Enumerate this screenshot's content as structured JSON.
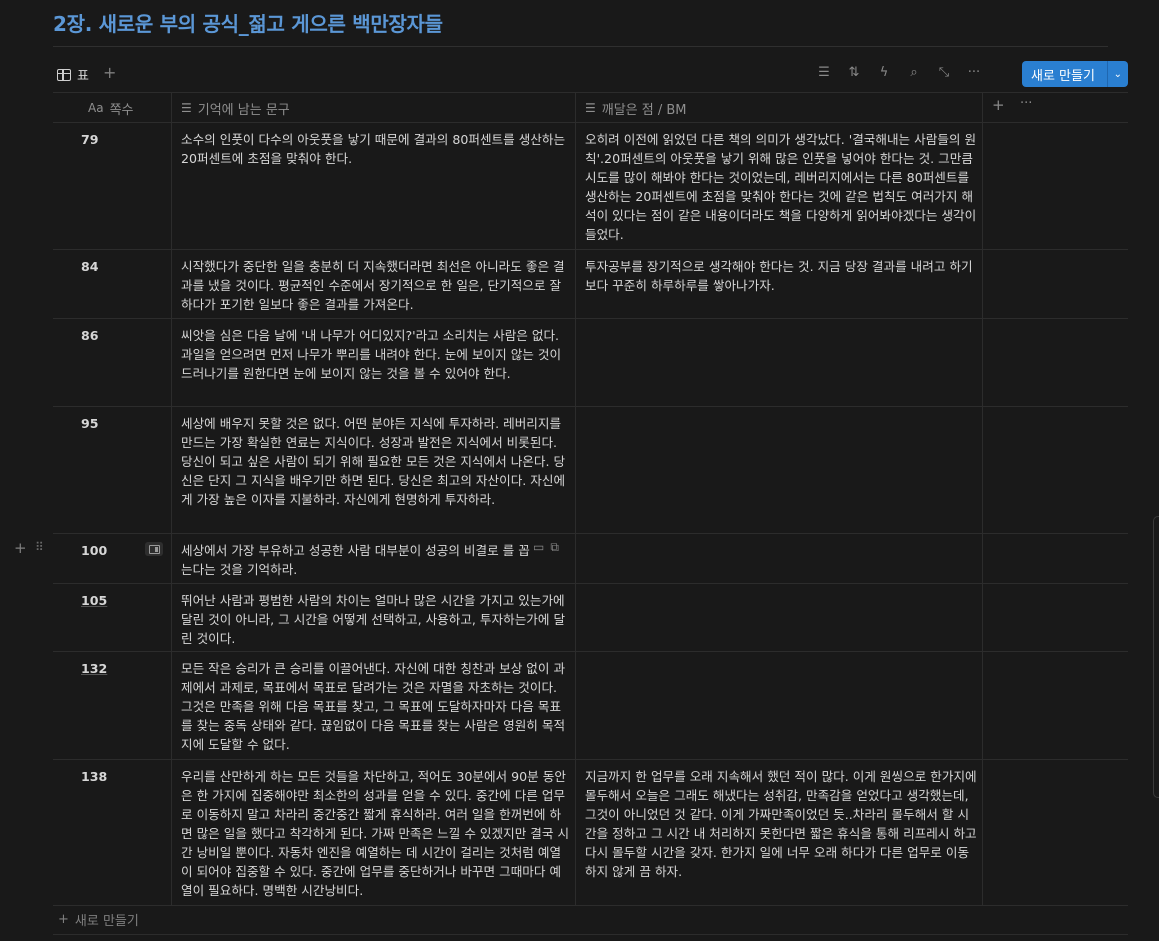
{
  "page": {
    "title": "2장. 새로운 부의 공식_젊고 게으른 백만장자들"
  },
  "toolbar": {
    "view_label": "표",
    "add_view": "+",
    "icons": [
      "filter-icon",
      "sort-icon",
      "automation-icon",
      "search-icon",
      "expand-icon",
      "more-icon"
    ],
    "new_label": "새로 만들기",
    "new_chevron": "⌄"
  },
  "columns": {
    "page": {
      "icon": "Aa",
      "label": "쪽수"
    },
    "memory": {
      "label": "기억에 남는 문구"
    },
    "note": {
      "label": "깨달은 점 / BM"
    },
    "add": "+",
    "more": "···"
  },
  "rows": [
    {
      "page": "79",
      "memory": "소수의 인풋이 다수의 아웃풋을 낳기 때문에 결과의 80퍼센트를 생산하는 20퍼센트에 초점을 맞춰야 한다.",
      "note": "오히려 이전에 읽었던 다른 책의 의미가 생각났다. '결국해내는 사람들의 원칙'.20퍼센트의 아웃풋을 낳기 위해 많은 인풋을 넣어야 한다는 것. 그만큼 시도를 많이 해봐야 한다는 것이었는데, 레버리지에서는 다른 80퍼센트를 생산하는 20퍼센트에 초점을 맞춰야 한다는 것에 같은 법칙도 여러가지 해석이 있다는 점이 같은 내용이더라도 책을 다양하게 읽어봐야겠다는 생각이 들었다."
    },
    {
      "page": "84",
      "memory": "시작했다가 중단한 일을 충분히 더 지속했더라면 최선은 아니라도 좋은 결과를 냈을 것이다. 평균적인 수준에서 장기적으로 한 일은, 단기적으로 잘하다가 포기한 일보다 좋은 결과를 가져온다.",
      "note": "투자공부를 장기적으로 생각해야 한다는 것. 지금 당장 결과를 내려고 하기보다 꾸준히 하루하루를 쌓아나가자."
    },
    {
      "page": "86",
      "memory": "씨앗을 심은 다음 날에 '내 나무가 어디있지?'라고 소리치는 사람은 없다. 과일을 얻으려면 먼저 나무가 뿌리를 내려야 한다. 눈에 보이지 않는 것이 드러나기를 원한다면 눈에 보이지 않는 것을 볼 수 있어야 한다.",
      "note": ""
    },
    {
      "page": "95",
      "memory": "세상에 배우지 못할 것은 없다. 어떤 분야든 지식에 투자하라. 레버리지를 만드는 가장 확실한 연료는 지식이다. 성장과 발전은 지식에서 비롯된다. 당신이 되고 싶은 사람이 되기 위해 필요한 모든 것은 지식에서 나온다. 당신은 단지 그 지식을 배우기만 하면 된다. 당신은 최고의 자산이다. 자신에게 가장 높은 이자를 지불하라. 자신에게 현명하게 투자하라.",
      "note": ""
    },
    {
      "page": "100",
      "memory": "세상에서 가장 부유하고 성공한 사람 대부분이 성공의 비결로 를 꼽는다는 것을 기억하라.",
      "note": ""
    },
    {
      "page": "105",
      "memory": "뛰어난 사람과 평범한 사람의 차이는 얼마나 많은 시간을 가지고 있는가에 달린 것이 아니라, 그 시간을 어떻게 선택하고, 사용하고, 투자하는가에 달린 것이다.",
      "note": ""
    },
    {
      "page": "132",
      "memory": "모든 작은 승리가 큰 승리를 이끌어낸다. 자신에 대한 칭찬과 보상 없이 과제에서 과제로, 목표에서 목표로 달려가는 것은 자멸을 자초하는 것이다. 그것은 만족을 위해 다음 목표를 찾고, 그 목표에 도달하자마자 다음 목표를 찾는 중독 상태와 같다. 끊임없이 다음 목표를 찾는 사람은 영원히 목적지에 도달할 수 없다.",
      "note": ""
    },
    {
      "page": "138",
      "memory": "우리를 산만하게 하는 모든 것들을 차단하고, 적어도 30분에서 90분 동안은 한 가지에 집중해야만 최소한의 성과를 얻을 수 있다. 중간에 다른 업무로 이동하지 말고 차라리 중간중간 짧게 휴식하라. 여러 일을 한꺼번에 하면 많은 일을 했다고 착각하게 된다. 가짜 만족은 느낄 수 있겠지만 결국 시간 낭비일 뿐이다. 자동차 엔진을 예열하는 데 시간이 걸리는 것처럼 예열이 되어야 집중할 수 있다. 중간에 업무를 중단하거나 바꾸면 그때마다 예열이 필요하다. 명백한 시간낭비다.",
      "note": "지금까지 한 업무를 오래 지속해서 했던 적이 많다. 이게 원씽으로 한가지에 몰두해서 오늘은 그래도 해냈다는 성취감, 만족감을 얻었다고 생각했는데, 그것이 아니었던 것 같다. 이게 가짜만족이었던 듯..차라리 몰두해서 할 시간을 정하고 그 시간 내 처리하지 못한다면 짧은 휴식을 통해 리프레시 하고 다시 몰두할 시간을 갖자. 한가지 일에 너무 오래 하다가 다른 업무로 이동하지 않게 끔 하자."
    }
  ],
  "footer": {
    "new_row": "새로 만들기"
  }
}
